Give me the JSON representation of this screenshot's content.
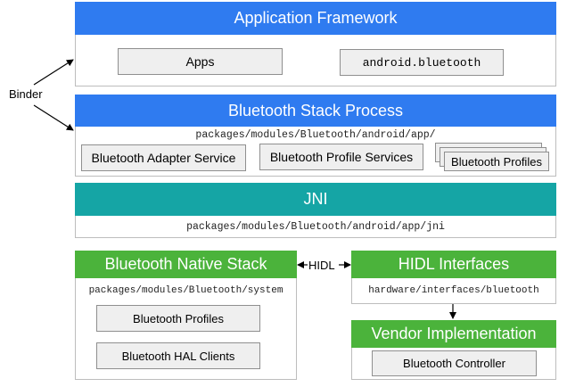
{
  "app_framework": {
    "title": "Application Framework",
    "apps": "Apps",
    "android_bluetooth": "android.bluetooth"
  },
  "binder_label": "Binder",
  "stack_process": {
    "title": "Bluetooth Stack Process",
    "path": "packages/modules/Bluetooth/android/app/",
    "adapter_service": "Bluetooth Adapter Service",
    "profile_services": "Bluetooth Profile Services",
    "profiles": "Bluetooth Profiles"
  },
  "jni": {
    "title": "JNI",
    "path": "packages/modules/Bluetooth/android/app/jni"
  },
  "native_stack": {
    "title": "Bluetooth Native Stack",
    "path": "packages/modules/Bluetooth/system",
    "profiles": "Bluetooth Profiles",
    "hal_clients": "Bluetooth HAL Clients"
  },
  "hidl_label": "HIDL",
  "hidl_interfaces": {
    "title": "HIDL Interfaces",
    "path": "hardware/interfaces/bluetooth"
  },
  "vendor": {
    "title": "Vendor Implementation",
    "controller": "Bluetooth Controller"
  },
  "colors": {
    "framework_blue": "#2f7bf0",
    "jni_teal": "#15a5a5",
    "native_green": "#4bb33b"
  }
}
